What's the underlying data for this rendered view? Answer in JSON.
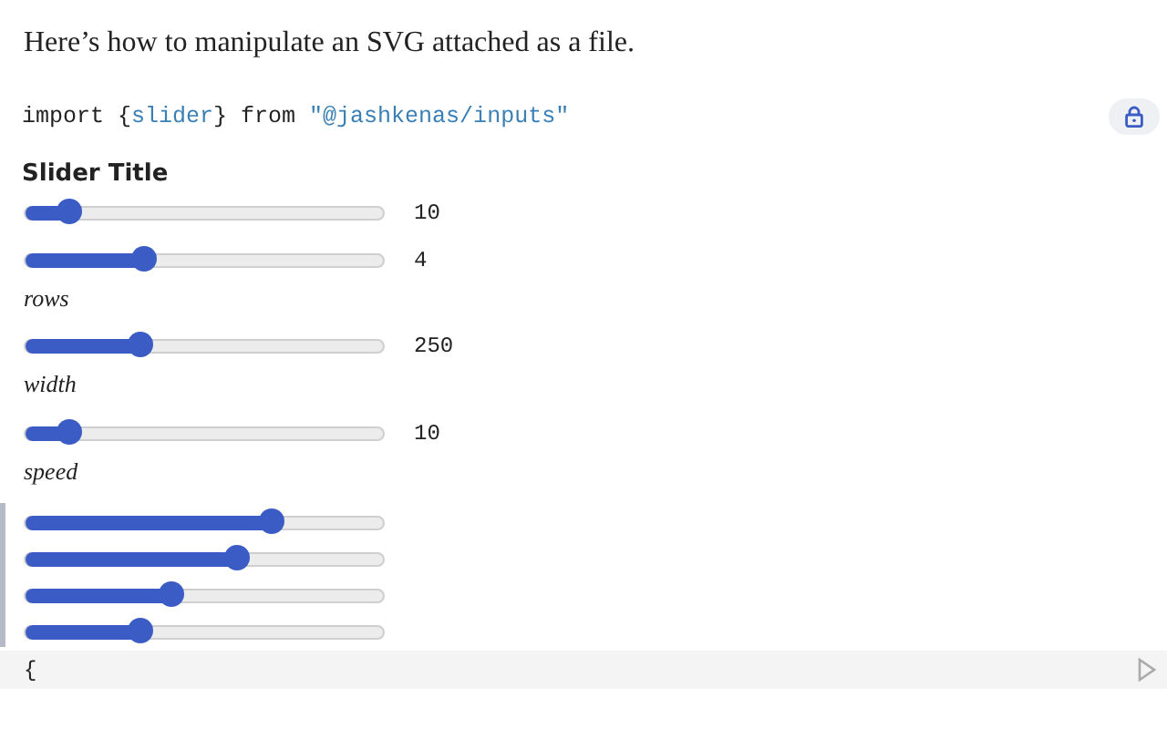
{
  "intro": "Here’s how to manipulate an SVG attached as a file.",
  "import_cell": {
    "parts": [
      {
        "kind": "plain",
        "text": "import {"
      },
      {
        "kind": "name",
        "text": "slider"
      },
      {
        "kind": "plain",
        "text": "} from "
      },
      {
        "kind": "string",
        "text": "\"@jashkenas/inputs\""
      }
    ]
  },
  "slider_title": "Slider Title",
  "sliders": [
    {
      "level": 0.12,
      "reading": "10"
    },
    {
      "level": 0.33,
      "reading": "4",
      "caption": "rows"
    },
    {
      "level": 0.32,
      "reading": "250",
      "caption": "width"
    },
    {
      "level": 0.12,
      "reading": "10",
      "caption": "speed"
    }
  ],
  "slider_group": [
    {
      "level": 0.69
    },
    {
      "level": 0.59
    },
    {
      "level": 0.41
    },
    {
      "level": 0.32
    }
  ],
  "code_cell": {
    "text": "{"
  }
}
